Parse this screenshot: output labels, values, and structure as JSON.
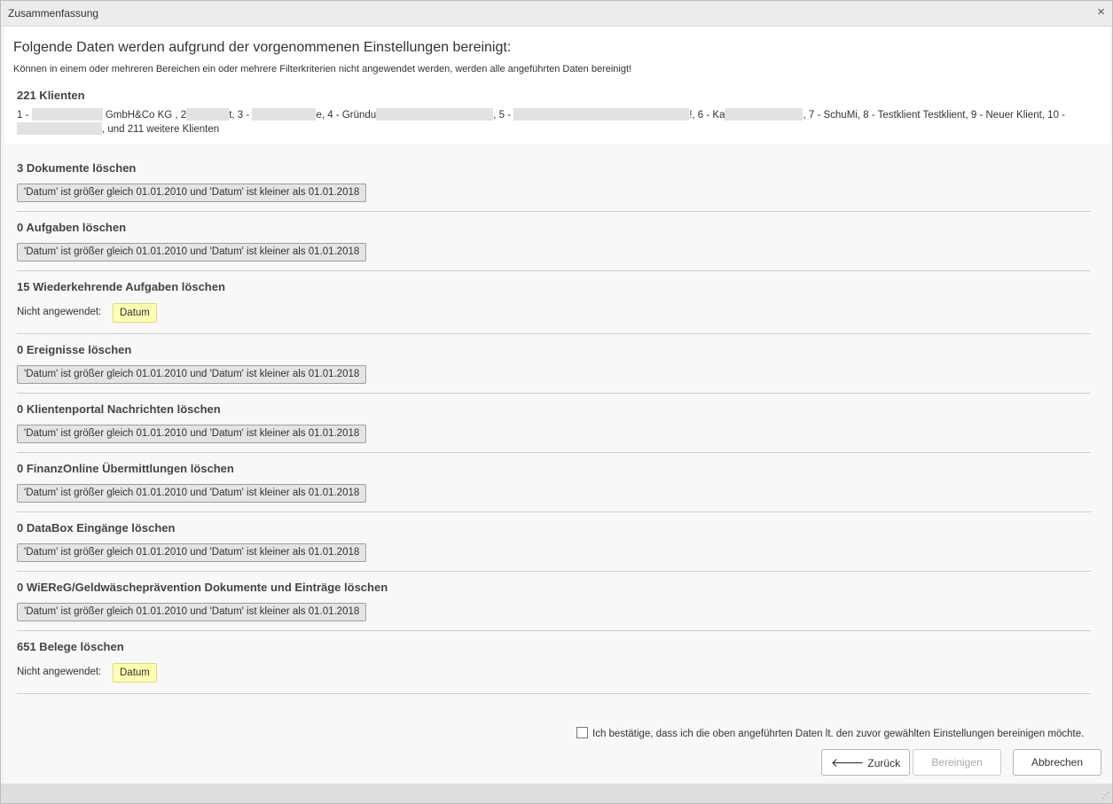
{
  "window": {
    "title": "Zusammenfassung",
    "close_icon": "×"
  },
  "header": {
    "heading": "Folgende Daten werden aufgrund der vorgenommenen Einstellungen bereinigt:",
    "subheading": "Können in einem oder mehreren Bereichen ein oder mehrere Filterkriterien nicht angewendet werden, werden alle angeführten Daten bereinigt!"
  },
  "clients": {
    "title": "221 Klienten",
    "p1": "1 - ",
    "p2": " GmbH&Co KG   , 2",
    "p3": "t, 3 - ",
    "p4": "e, 4 - Gründu",
    "p5": ", 5 - ",
    "p6": "!, 6 - Ka",
    "p7": ", 7 - SchuMi, 8 - Testklient Testklient, 9 - Neuer Klient, 10 -",
    "p8": ", und 211 weitere Klienten"
  },
  "filter_text": "'Datum' ist größer gleich 01.01.2010 und 'Datum' ist kleiner als 01.01.2018",
  "not_applied_label": "Nicht angewendet:",
  "not_applied_value": "Datum",
  "sections": [
    {
      "title": "3 Dokumente löschen"
    },
    {
      "title": "0 Aufgaben löschen"
    },
    {
      "title": "15 Wiederkehrende Aufgaben löschen"
    },
    {
      "title": "0 Ereignisse löschen"
    },
    {
      "title": "0 Klientenportal Nachrichten löschen"
    },
    {
      "title": "0 FinanzOnline Übermittlungen löschen"
    },
    {
      "title": "0 DataBox Eingänge löschen"
    },
    {
      "title": "0 WiEReG/Geldwäscheprävention Dokumente und Einträge löschen"
    },
    {
      "title": "651 Belege löschen"
    }
  ],
  "confirm": {
    "label": "Ich bestätige, dass ich die oben angeführten Daten lt. den zuvor gewählten Einstellungen bereinigen möchte."
  },
  "buttons": {
    "back_arrow": "🡐",
    "back": "Zurück",
    "clean": "Bereinigen",
    "cancel": "Abbrechen"
  }
}
